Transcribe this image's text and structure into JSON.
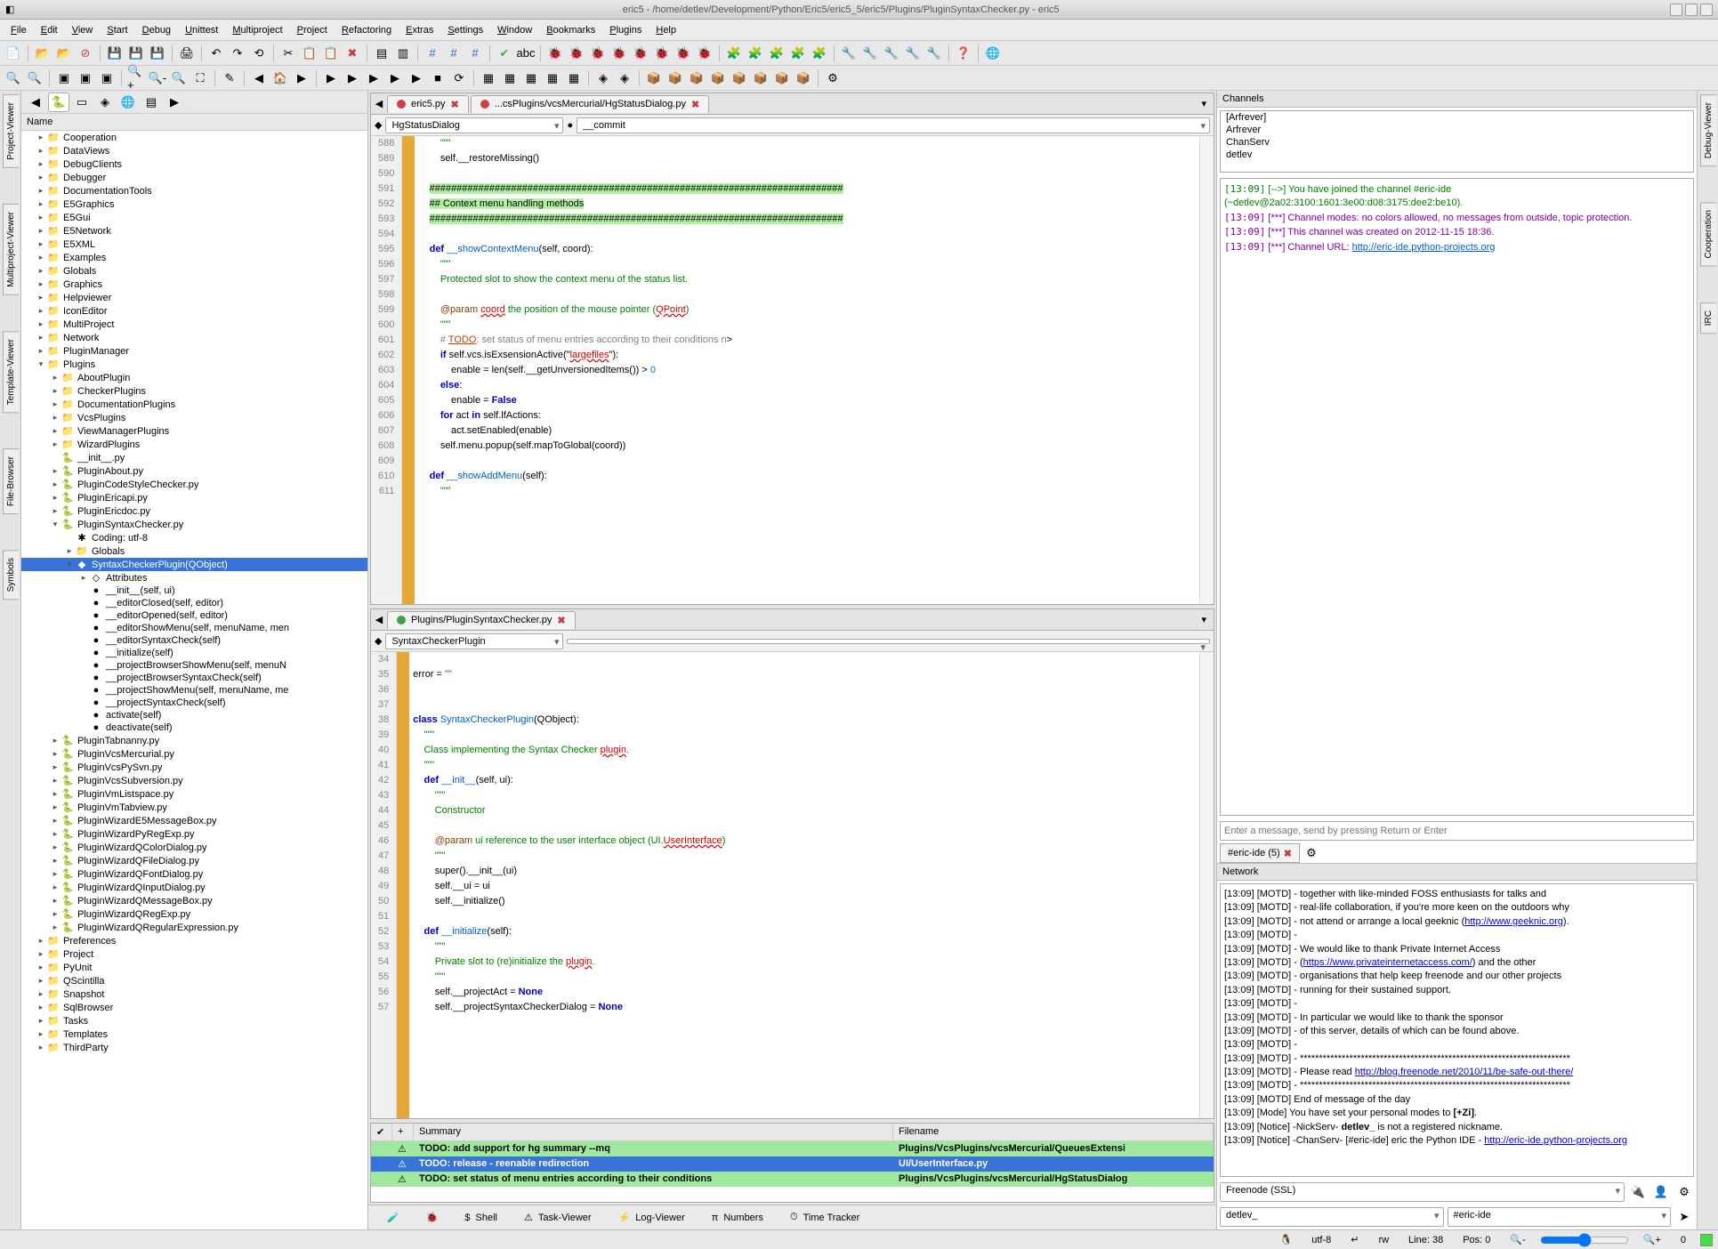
{
  "window": {
    "title": "eric5 - /home/detlev/Development/Python/Eric5/eric5_5/eric5/Plugins/PluginSyntaxChecker.py - eric5"
  },
  "menu": [
    "File",
    "Edit",
    "View",
    "Start",
    "Debug",
    "Unittest",
    "Multiproject",
    "Project",
    "Refactoring",
    "Extras",
    "Settings",
    "Window",
    "Bookmarks",
    "Plugins",
    "Help"
  ],
  "leftTabs": [
    "Project-Viewer",
    "Multiproject-Viewer",
    "Template-Viewer",
    "File-Browser",
    "Symbols"
  ],
  "rightTabs": [
    "Debug-Viewer",
    "Cooperation",
    "IRC"
  ],
  "tree": {
    "header": "Name",
    "items": [
      {
        "d": 1,
        "exp": "▸",
        "ico": "📁",
        "label": "Cooperation"
      },
      {
        "d": 1,
        "exp": "▸",
        "ico": "📁",
        "label": "DataViews"
      },
      {
        "d": 1,
        "exp": "▸",
        "ico": "📁",
        "label": "DebugClients"
      },
      {
        "d": 1,
        "exp": "▸",
        "ico": "📁",
        "label": "Debugger"
      },
      {
        "d": 1,
        "exp": "▸",
        "ico": "📁",
        "label": "DocumentationTools"
      },
      {
        "d": 1,
        "exp": "▸",
        "ico": "📁",
        "label": "E5Graphics"
      },
      {
        "d": 1,
        "exp": "▸",
        "ico": "📁",
        "label": "E5Gui"
      },
      {
        "d": 1,
        "exp": "▸",
        "ico": "📁",
        "label": "E5Network"
      },
      {
        "d": 1,
        "exp": "▸",
        "ico": "📁",
        "label": "E5XML"
      },
      {
        "d": 1,
        "exp": "▸",
        "ico": "📁",
        "label": "Examples"
      },
      {
        "d": 1,
        "exp": "▸",
        "ico": "📁",
        "label": "Globals"
      },
      {
        "d": 1,
        "exp": "▸",
        "ico": "📁",
        "label": "Graphics"
      },
      {
        "d": 1,
        "exp": "▸",
        "ico": "📁",
        "label": "Helpviewer"
      },
      {
        "d": 1,
        "exp": "▸",
        "ico": "📁",
        "label": "IconEditor"
      },
      {
        "d": 1,
        "exp": "▸",
        "ico": "📁",
        "label": "MultiProject"
      },
      {
        "d": 1,
        "exp": "▸",
        "ico": "📁",
        "label": "Network"
      },
      {
        "d": 1,
        "exp": "▸",
        "ico": "📁",
        "label": "PluginManager"
      },
      {
        "d": 1,
        "exp": "▾",
        "ico": "📁",
        "label": "Plugins"
      },
      {
        "d": 2,
        "exp": "▸",
        "ico": "📁",
        "label": "AboutPlugin"
      },
      {
        "d": 2,
        "exp": "▸",
        "ico": "📁",
        "label": "CheckerPlugins"
      },
      {
        "d": 2,
        "exp": "▸",
        "ico": "📁",
        "label": "DocumentationPlugins"
      },
      {
        "d": 2,
        "exp": "▸",
        "ico": "📁",
        "label": "VcsPlugins"
      },
      {
        "d": 2,
        "exp": "▸",
        "ico": "📁",
        "label": "ViewManagerPlugins"
      },
      {
        "d": 2,
        "exp": "▸",
        "ico": "📁",
        "label": "WizardPlugins"
      },
      {
        "d": 2,
        "exp": "",
        "ico": "🐍",
        "label": "__init__.py"
      },
      {
        "d": 2,
        "exp": "▸",
        "ico": "🐍",
        "label": "PluginAbout.py"
      },
      {
        "d": 2,
        "exp": "▸",
        "ico": "🐍",
        "label": "PluginCodeStyleChecker.py"
      },
      {
        "d": 2,
        "exp": "▸",
        "ico": "🐍",
        "label": "PluginEricapi.py"
      },
      {
        "d": 2,
        "exp": "▸",
        "ico": "🐍",
        "label": "PluginEricdoc.py"
      },
      {
        "d": 2,
        "exp": "▾",
        "ico": "🐍",
        "label": "PluginSyntaxChecker.py"
      },
      {
        "d": 3,
        "exp": "",
        "ico": "✱",
        "label": "Coding: utf-8"
      },
      {
        "d": 3,
        "exp": "▸",
        "ico": "📁",
        "label": "Globals"
      },
      {
        "d": 3,
        "exp": "▾",
        "ico": "◆",
        "label": "SyntaxCheckerPlugin(QObject)",
        "sel": true
      },
      {
        "d": 4,
        "exp": "▸",
        "ico": "◇",
        "label": "Attributes"
      },
      {
        "d": 4,
        "exp": "",
        "ico": "●",
        "label": "__init__(self, ui)"
      },
      {
        "d": 4,
        "exp": "",
        "ico": "●",
        "label": "__editorClosed(self, editor)"
      },
      {
        "d": 4,
        "exp": "",
        "ico": "●",
        "label": "__editorOpened(self, editor)"
      },
      {
        "d": 4,
        "exp": "",
        "ico": "●",
        "label": "__editorShowMenu(self, menuName, men"
      },
      {
        "d": 4,
        "exp": "",
        "ico": "●",
        "label": "__editorSyntaxCheck(self)"
      },
      {
        "d": 4,
        "exp": "",
        "ico": "●",
        "label": "__initialize(self)"
      },
      {
        "d": 4,
        "exp": "",
        "ico": "●",
        "label": "__projectBrowserShowMenu(self, menuN"
      },
      {
        "d": 4,
        "exp": "",
        "ico": "●",
        "label": "__projectBrowserSyntaxCheck(self)"
      },
      {
        "d": 4,
        "exp": "",
        "ico": "●",
        "label": "__projectShowMenu(self, menuName, me"
      },
      {
        "d": 4,
        "exp": "",
        "ico": "●",
        "label": "__projectSyntaxCheck(self)"
      },
      {
        "d": 4,
        "exp": "",
        "ico": "●",
        "label": "activate(self)"
      },
      {
        "d": 4,
        "exp": "",
        "ico": "●",
        "label": "deactivate(self)"
      },
      {
        "d": 2,
        "exp": "▸",
        "ico": "🐍",
        "label": "PluginTabnanny.py"
      },
      {
        "d": 2,
        "exp": "▸",
        "ico": "🐍",
        "label": "PluginVcsMercurial.py"
      },
      {
        "d": 2,
        "exp": "▸",
        "ico": "🐍",
        "label": "PluginVcsPySvn.py"
      },
      {
        "d": 2,
        "exp": "▸",
        "ico": "🐍",
        "label": "PluginVcsSubversion.py"
      },
      {
        "d": 2,
        "exp": "▸",
        "ico": "🐍",
        "label": "PluginVmListspace.py"
      },
      {
        "d": 2,
        "exp": "▸",
        "ico": "🐍",
        "label": "PluginVmTabview.py"
      },
      {
        "d": 2,
        "exp": "▸",
        "ico": "🐍",
        "label": "PluginWizardE5MessageBox.py"
      },
      {
        "d": 2,
        "exp": "▸",
        "ico": "🐍",
        "label": "PluginWizardPyRegExp.py"
      },
      {
        "d": 2,
        "exp": "▸",
        "ico": "🐍",
        "label": "PluginWizardQColorDialog.py"
      },
      {
        "d": 2,
        "exp": "▸",
        "ico": "🐍",
        "label": "PluginWizardQFileDialog.py"
      },
      {
        "d": 2,
        "exp": "▸",
        "ico": "🐍",
        "label": "PluginWizardQFontDialog.py"
      },
      {
        "d": 2,
        "exp": "▸",
        "ico": "🐍",
        "label": "PluginWizardQInputDialog.py"
      },
      {
        "d": 2,
        "exp": "▸",
        "ico": "🐍",
        "label": "PluginWizardQMessageBox.py"
      },
      {
        "d": 2,
        "exp": "▸",
        "ico": "🐍",
        "label": "PluginWizardQRegExp.py"
      },
      {
        "d": 2,
        "exp": "▸",
        "ico": "🐍",
        "label": "PluginWizardQRegularExpression.py"
      },
      {
        "d": 1,
        "exp": "▸",
        "ico": "📁",
        "label": "Preferences"
      },
      {
        "d": 1,
        "exp": "▸",
        "ico": "📁",
        "label": "Project"
      },
      {
        "d": 1,
        "exp": "▸",
        "ico": "📁",
        "label": "PyUnit"
      },
      {
        "d": 1,
        "exp": "▸",
        "ico": "📁",
        "label": "QScintilla"
      },
      {
        "d": 1,
        "exp": "▸",
        "ico": "📁",
        "label": "Snapshot"
      },
      {
        "d": 1,
        "exp": "▸",
        "ico": "📁",
        "label": "SqlBrowser"
      },
      {
        "d": 1,
        "exp": "▸",
        "ico": "📁",
        "label": "Tasks"
      },
      {
        "d": 1,
        "exp": "▸",
        "ico": "📁",
        "label": "Templates"
      },
      {
        "d": 1,
        "exp": "▸",
        "ico": "📁",
        "label": "ThirdParty"
      }
    ]
  },
  "editor1": {
    "tabs": [
      {
        "dot": "red",
        "label": "eric5.py"
      },
      {
        "dot": "red",
        "label": "...csPlugins/vcsMercurial/HgStatusDialog.py"
      }
    ],
    "nav": {
      "left": "HgStatusDialog",
      "right": "__commit"
    },
    "startLine": 588,
    "lines": [
      "        <span class='str'>\"\"\"</span>",
      "        <span class='self'>self</span>.__restoreMissing()",
      "",
      "    <span class='hl-green'>############################################################################</span>",
      "    <span class='hl-green'>## Context menu handling methods</span>",
      "    <span class='hl-green'>############################################################################</span>",
      "",
      "    <span class='kw'>def</span> <span class='fn'>__showContextMenu</span>(<span class='self'>self</span>, coord):",
      "        <span class='str'>\"\"\"</span>",
      "        <span class='str'>Protected slot to show the context menu of the status list.</span>",
      "",
      "        <span class='param'>@param</span> <span class='err'>coord</span> <span class='str'>the position of the mouse pointer (</span><span class='err'>QPoint</span><span class='str'>)</span>",
      "        <span class='str'>\"\"\"</span>",
      "        <span class='cmt'># </span><span class='todo'>TODO</span><span class='cmt'>: set status of menu entries according to their conditions n</span>>",
      "        <span class='kw'>if</span> <span class='self'>self</span>.vcs.isExsensionActive(<span class class='str'>\"<span class='err'>largefiles</span>\"</span>):",
      "            enable = len(<span class='self'>self</span>.__getUnversionedItems()) > <span class='num'>0</span>",
      "        <span class='kw'>else</span>:",
      "            enable = <span class='kw'>False</span>",
      "        <span class='kw'>for</span> act <span class='kw'>in</span> <span class='self'>self</span>.lfActions:",
      "            act.setEnabled(enable)",
      "        <span class='self'>self</span>.menu.popup(<span class='self'>self</span>.mapToGlobal(coord))",
      "",
      "    <span class='kw'>def</span> <span class='fn'>__showAddMenu</span>(<span class='self'>self</span>):",
      "        <span class='str'>\"\"\"</span>"
    ]
  },
  "editor2": {
    "tabs": [
      {
        "dot": "green",
        "label": "Plugins/PluginSyntaxChecker.py"
      }
    ],
    "nav": {
      "left": "SyntaxCheckerPlugin",
      "right": ""
    },
    "startLine": 34,
    "lines": [
      "",
      "error = <span class='str'>\"\"</span>",
      "",
      "",
      "<span class='kw'>class</span> <span class='fn'>SyntaxCheckerPlugin</span>(QObject):",
      "    <span class='str'>\"\"\"</span>",
      "    <span class='str'>Class implementing the Syntax Checker <span class='err'>plugin</span>.</span>",
      "    <span class='str'>\"\"\"</span>",
      "    <span class='kw'>def</span> <span class='fn'>__init__</span>(<span class='self'>self</span>, ui):",
      "        <span class='str'>\"\"\"</span>",
      "        <span class='str'>Constructor</span>",
      "",
      "        <span class='param'>@param</span><span class='str'> ui reference to the user interface object (UI.<span class='err'>UserInterface</span>)</span>",
      "        <span class='str'>\"\"\"</span>",
      "        super().__init__(ui)",
      "        <span class='self'>self</span>.__ui = ui",
      "        <span class='self'>self</span>.__initialize()",
      "",
      "    <span class='kw'>def</span> <span class='fn'>__initialize</span>(<span class='self'>self</span>):",
      "        <span class='str'>\"\"\"</span>",
      "        <span class='str'>Private slot to (re)initialize the <span class='err'>plugin</span>.</span>",
      "        <span class='str'>\"\"\"</span>",
      "        <span class='self'>self</span>.__projectAct = <span class='kw'>None</span>",
      "        <span class='self'>self</span>.__projectSyntaxCheckerDialog = <span class='kw'>None</span>"
    ]
  },
  "tasks": {
    "headers": [
      "",
      "",
      "Summary",
      "Filename"
    ],
    "rows": [
      {
        "cls": "g",
        "summary": "TODO: add support for hg summary --mq",
        "file": "Plugins/VcsPlugins/vcsMercurial/QueuesExtensi"
      },
      {
        "cls": "sel",
        "summary": "TODO: release - reenable redirection",
        "file": "UI/UserInterface.py"
      },
      {
        "cls": "g",
        "summary": "TODO: set status of menu entries according to their conditions",
        "file": "Plugins/VcsPlugins/vcsMercurial/HgStatusDialog"
      }
    ]
  },
  "bottomTabs": [
    {
      "ico": "🧪",
      "label": ""
    },
    {
      "ico": "🐞",
      "label": ""
    },
    {
      "ico": "$",
      "label": "Shell"
    },
    {
      "ico": "⚠",
      "label": "Task-Viewer"
    },
    {
      "ico": "⚡",
      "label": "Log-Viewer"
    },
    {
      "ico": "π",
      "label": "Numbers"
    },
    {
      "ico": "⏱",
      "label": "Time Tracker"
    }
  ],
  "chat": {
    "title": "Channels",
    "users": [
      "[Arfrever]",
      "Arfrever",
      "ChanServ",
      "detlev"
    ],
    "log": [
      {
        "ts": "[13:09]",
        "cls": "green",
        "html": "[--&gt;] You have joined the channel #eric-ide (~detlev@2a02:3100:1601:3e00:d08:3175:dee2:be10)."
      },
      {
        "ts": "[13:09]",
        "cls": "purple",
        "html": "[***] Channel modes: no colors allowed, no messages from outside, topic protection."
      },
      {
        "ts": "[13:09]",
        "cls": "purple",
        "html": "[***] This channel was created on 2012-11-15 18:36."
      },
      {
        "ts": "[13:09]",
        "cls": "purple",
        "html": "[***] Channel URL: <a href='#'>http://eric-ide.python-projects.org</a>"
      }
    ],
    "inputPlaceholder": "Enter a message, send by pressing Return or Enter",
    "tab": "#eric-ide (5)"
  },
  "network": {
    "title": "Network",
    "log": [
      {
        "ts": "[13:09]",
        "html": "[MOTD] - together with like-minded FOSS enthusiasts for talks and"
      },
      {
        "ts": "[13:09]",
        "html": "[MOTD] - real-life collaboration, if you're more keen on the outdoors why"
      },
      {
        "ts": "[13:09]",
        "html": "[MOTD] - not attend or arrange a local geeknic (<a href='#'>http://www.geeknic.org</a>)."
      },
      {
        "ts": "[13:09]",
        "html": "[MOTD] -"
      },
      {
        "ts": "[13:09]",
        "html": "[MOTD] - We would like to thank Private Internet Access"
      },
      {
        "ts": "[13:09]",
        "html": "[MOTD] - (<a href='#'>https://www.privateinternetaccess.com/</a>) and the other"
      },
      {
        "ts": "[13:09]",
        "html": "[MOTD] - organisations that help keep freenode and our other projects"
      },
      {
        "ts": "[13:09]",
        "html": "[MOTD] - running for their sustained support."
      },
      {
        "ts": "[13:09]",
        "html": "[MOTD] -"
      },
      {
        "ts": "[13:09]",
        "html": "[MOTD] - In particular we would like to thank the sponsor"
      },
      {
        "ts": "[13:09]",
        "html": "[MOTD] - of this server, details of which can be found above."
      },
      {
        "ts": "[13:09]",
        "html": "[MOTD] -"
      },
      {
        "ts": "[13:09]",
        "html": "[MOTD] - ***********************************************************************"
      },
      {
        "ts": "[13:09]",
        "html": "[MOTD] - Please read <a href='#'>http://blog.freenode.net/2010/11/be-safe-out-there/</a>"
      },
      {
        "ts": "[13:09]",
        "html": "[MOTD] - ***********************************************************************"
      },
      {
        "ts": "[13:09]",
        "html": "[MOTD] End of message of the day"
      },
      {
        "ts": "[13:09]",
        "html": "[Mode] You have set your personal modes to <b>[+Zi]</b>."
      },
      {
        "ts": "[13:09]",
        "html": "[Notice] -NickServ- <b>detlev_</b> is not a registered nickname."
      },
      {
        "ts": "[13:09]",
        "html": "[Notice] -ChanServ- [#eric-ide] eric the Python IDE - <a href='#'>http://eric-ide.python-projects.org</a>"
      }
    ],
    "server": "Freenode (SSL)",
    "nick": "detlev_",
    "channel": "#eric-ide"
  },
  "status": {
    "encoding": "utf-8",
    "eol": "",
    "mode": "rw",
    "line": "Line: 38",
    "pos": "Pos: 0",
    "zoom": "0"
  }
}
